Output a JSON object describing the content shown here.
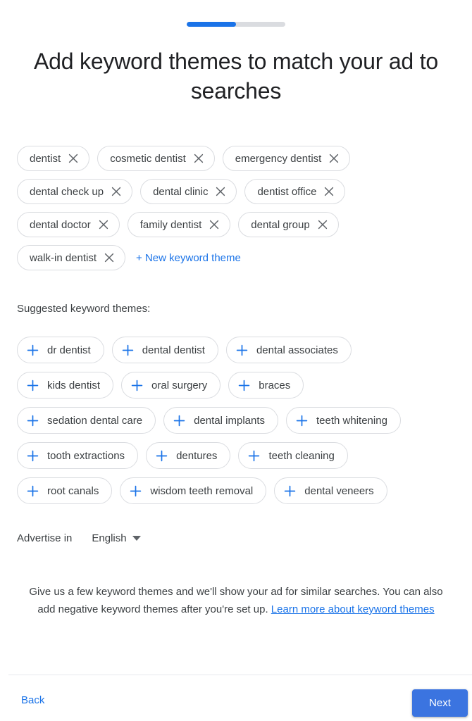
{
  "progress": {
    "percent": 50,
    "fill_color": "#1a73e8",
    "track_color": "#dadce0"
  },
  "header": {
    "title": "Add keyword themes to match your ad to searches"
  },
  "keyword_themes": {
    "rows": [
      [
        "dentist",
        "cosmetic dentist",
        "emergency dentist"
      ],
      [
        "dental check up",
        "dental clinic",
        "dentist office"
      ],
      [
        "dental doctor",
        "family dentist",
        "dental group"
      ],
      [
        "walk-in dentist"
      ]
    ],
    "new_theme_label": "+ New keyword theme",
    "remove_icon": "close-icon"
  },
  "suggested": {
    "label": "Suggested keyword themes:",
    "add_icon": "plus-icon",
    "rows": [
      [
        "dr dentist",
        "dental dentist",
        "dental associates"
      ],
      [
        "kids dentist",
        "oral surgery",
        "braces"
      ],
      [
        "sedation dental care",
        "dental implants",
        "teeth whitening"
      ],
      [
        "tooth extractions",
        "dentures",
        "teeth cleaning"
      ],
      [
        "root canals",
        "wisdom teeth removal",
        "dental veneers"
      ]
    ]
  },
  "advertise": {
    "label": "Advertise in",
    "language": "English",
    "caret_icon": "chevron-down-icon"
  },
  "helper": {
    "text_before": "Give us a few keyword themes and we'll show your ad for similar searches. You can also add negative keyword themes after you're set up. ",
    "link_text": "Learn more about keyword themes"
  },
  "footer": {
    "back_label": "Back",
    "next_label": "Next",
    "accent_color": "#1a73e8",
    "next_button_color": "#3b74e0"
  }
}
